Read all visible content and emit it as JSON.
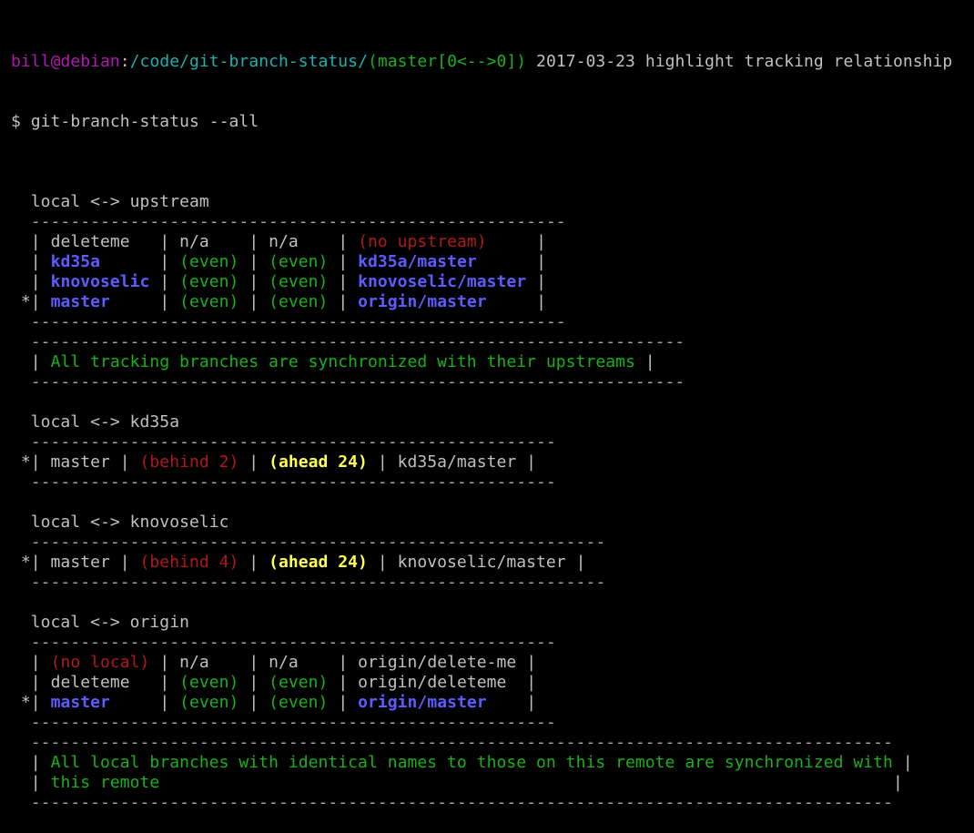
{
  "prompt": {
    "user": "bill",
    "at": "@",
    "host": "debian",
    "sep": ":",
    "path": "/code/git-branch-status/",
    "git": "(master[0<-->0])",
    "commit": " 2017-03-23 highlight tracking relationship"
  },
  "command": "$ git-branch-status --all",
  "lines": [
    [],
    [
      {
        "t": "  local <-> upstream",
        "c": "gray"
      }
    ],
    [
      {
        "t": "  ------------------------------------------------------",
        "c": "dash"
      }
    ],
    [
      {
        "t": "  | ",
        "c": "gray"
      },
      {
        "t": "deleteme  ",
        "c": "gray"
      },
      {
        "t": " | ",
        "c": "gray"
      },
      {
        "t": "n/a   ",
        "c": "gray"
      },
      {
        "t": " | ",
        "c": "gray"
      },
      {
        "t": "n/a   ",
        "c": "gray"
      },
      {
        "t": " | ",
        "c": "gray"
      },
      {
        "t": "(no upstream)",
        "c": "red"
      },
      {
        "t": "     |",
        "c": "gray"
      }
    ],
    [
      {
        "t": "  | ",
        "c": "gray"
      },
      {
        "t": "kd35a",
        "c": "blue"
      },
      {
        "t": "      | ",
        "c": "gray"
      },
      {
        "t": "(even)",
        "c": "green"
      },
      {
        "t": " | ",
        "c": "gray"
      },
      {
        "t": "(even)",
        "c": "green"
      },
      {
        "t": " | ",
        "c": "gray"
      },
      {
        "t": "kd35a/master",
        "c": "blue"
      },
      {
        "t": "      |",
        "c": "gray"
      }
    ],
    [
      {
        "t": "  | ",
        "c": "gray"
      },
      {
        "t": "knovoselic",
        "c": "blue"
      },
      {
        "t": " | ",
        "c": "gray"
      },
      {
        "t": "(even)",
        "c": "green"
      },
      {
        "t": " | ",
        "c": "gray"
      },
      {
        "t": "(even)",
        "c": "green"
      },
      {
        "t": " | ",
        "c": "gray"
      },
      {
        "t": "knovoselic/master",
        "c": "blue"
      },
      {
        "t": " |",
        "c": "gray"
      }
    ],
    [
      {
        "t": " *| ",
        "c": "gray"
      },
      {
        "t": "master",
        "c": "blue"
      },
      {
        "t": "     | ",
        "c": "gray"
      },
      {
        "t": "(even)",
        "c": "green"
      },
      {
        "t": " | ",
        "c": "gray"
      },
      {
        "t": "(even)",
        "c": "green"
      },
      {
        "t": " | ",
        "c": "gray"
      },
      {
        "t": "origin/master",
        "c": "blue"
      },
      {
        "t": "     |",
        "c": "gray"
      }
    ],
    [
      {
        "t": "  ------------------------------------------------------",
        "c": "dash"
      }
    ],
    [
      {
        "t": "  ------------------------------------------------------------------",
        "c": "dash"
      }
    ],
    [
      {
        "t": "  | ",
        "c": "gray"
      },
      {
        "t": "All tracking branches are synchronized with their upstreams",
        "c": "green"
      },
      {
        "t": " |",
        "c": "gray"
      }
    ],
    [
      {
        "t": "  ------------------------------------------------------------------",
        "c": "dash"
      }
    ],
    [],
    [
      {
        "t": "  local <-> kd35a",
        "c": "gray"
      }
    ],
    [
      {
        "t": "  -----------------------------------------------------",
        "c": "dash"
      }
    ],
    [
      {
        "t": " *| master | ",
        "c": "gray"
      },
      {
        "t": "(behind 2)",
        "c": "red"
      },
      {
        "t": " | ",
        "c": "gray"
      },
      {
        "t": "(ahead 24)",
        "c": "yellow"
      },
      {
        "t": " | kd35a/master |",
        "c": "gray"
      }
    ],
    [
      {
        "t": "  -----------------------------------------------------",
        "c": "dash"
      }
    ],
    [],
    [
      {
        "t": "  local <-> knovoselic",
        "c": "gray"
      }
    ],
    [
      {
        "t": "  ----------------------------------------------------------",
        "c": "dash"
      }
    ],
    [
      {
        "t": " *| master | ",
        "c": "gray"
      },
      {
        "t": "(behind 4)",
        "c": "red"
      },
      {
        "t": " | ",
        "c": "gray"
      },
      {
        "t": "(ahead 24)",
        "c": "yellow"
      },
      {
        "t": " | knovoselic/master |",
        "c": "gray"
      }
    ],
    [
      {
        "t": "  ----------------------------------------------------------",
        "c": "dash"
      }
    ],
    [],
    [
      {
        "t": "  local <-> origin",
        "c": "gray"
      }
    ],
    [
      {
        "t": "  -----------------------------------------------------",
        "c": "dash"
      }
    ],
    [
      {
        "t": "  | ",
        "c": "gray"
      },
      {
        "t": "(no local)",
        "c": "red"
      },
      {
        "t": " | ",
        "c": "gray"
      },
      {
        "t": "n/a   ",
        "c": "gray"
      },
      {
        "t": " | ",
        "c": "gray"
      },
      {
        "t": "n/a   ",
        "c": "gray"
      },
      {
        "t": " | ",
        "c": "gray"
      },
      {
        "t": "origin/delete-me",
        "c": "gray"
      },
      {
        "t": " |",
        "c": "gray"
      }
    ],
    [
      {
        "t": "  | ",
        "c": "gray"
      },
      {
        "t": "deleteme  ",
        "c": "gray"
      },
      {
        "t": " | ",
        "c": "gray"
      },
      {
        "t": "(even)",
        "c": "green"
      },
      {
        "t": " | ",
        "c": "gray"
      },
      {
        "t": "(even)",
        "c": "green"
      },
      {
        "t": " | ",
        "c": "gray"
      },
      {
        "t": "origin/deleteme ",
        "c": "gray"
      },
      {
        "t": " |",
        "c": "gray"
      }
    ],
    [
      {
        "t": " *| ",
        "c": "gray"
      },
      {
        "t": "master",
        "c": "blue"
      },
      {
        "t": "     | ",
        "c": "gray"
      },
      {
        "t": "(even)",
        "c": "green"
      },
      {
        "t": " | ",
        "c": "gray"
      },
      {
        "t": "(even)",
        "c": "green"
      },
      {
        "t": " | ",
        "c": "gray"
      },
      {
        "t": "origin/master",
        "c": "blue"
      },
      {
        "t": "    |",
        "c": "gray"
      }
    ],
    [
      {
        "t": "  -----------------------------------------------------",
        "c": "dash"
      }
    ],
    [
      {
        "t": "  ---------------------------------------------------------------------------------------",
        "c": "dash"
      }
    ],
    [
      {
        "t": "  | ",
        "c": "gray"
      },
      {
        "t": "All local branches with identical names to those on this remote are synchronized with",
        "c": "green"
      },
      {
        "t": " |",
        "c": "gray"
      }
    ],
    [
      {
        "t": "  | ",
        "c": "gray"
      },
      {
        "t": "this remote",
        "c": "green"
      },
      {
        "t": "                                                                          |",
        "c": "gray"
      }
    ],
    [
      {
        "t": "  ---------------------------------------------------------------------------------------",
        "c": "dash"
      }
    ]
  ]
}
